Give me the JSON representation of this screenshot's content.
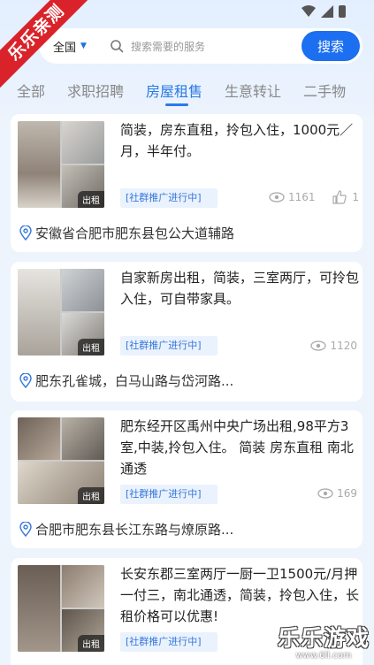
{
  "status": {
    "icons": [
      "wifi-icon",
      "signal-icon",
      "battery-icon"
    ]
  },
  "ribbon": "乐乐亲测",
  "search": {
    "city": "全国",
    "placeholder": "搜索需要的服务",
    "button": "搜索"
  },
  "tabs": [
    {
      "label": "全部"
    },
    {
      "label": "求职招聘"
    },
    {
      "label": "房屋租售",
      "active": true
    },
    {
      "label": "生意转让"
    },
    {
      "label": "二手物"
    }
  ],
  "listings": [
    {
      "title": "简装，房东直租，拎包入住，1000元／月，半年付。",
      "rent_tag": "出租",
      "promo": "[社群推广进行中]",
      "views": "1161",
      "likes": "1",
      "location": "安徽省合肥市肥东县包公大道辅路"
    },
    {
      "title": "自家新房出租，简装，三室两厅，可拎包入住，可自带家具。",
      "rent_tag": "出租",
      "promo": "[社群推广进行中]",
      "views": "1120",
      "location": "肥东孔雀城，白马山路与岱河路..."
    },
    {
      "title": "肥东经开区禹州中央广场出租,98平方3室,中装,拎包入住。 简装 房东直租 南北通透",
      "rent_tag": "出租",
      "promo": "[社群推广进行中]",
      "views": "169",
      "location": "合肥市肥东县长江东路与燎原路..."
    },
    {
      "title": "长安东郡三室两厅一厨一卫1500元/月押一付三，南北通透，简装，拎包入住，长租价格可以优惠!",
      "rent_tag": "出租",
      "promo": "[社群推广进行中]"
    }
  ],
  "watermark": {
    "title": "乐乐游戏",
    "url": "www.6ll.com"
  },
  "colors": {
    "accent": "#1b6ff0",
    "ribbon": "#d9222a",
    "bg": "#eef4fc"
  }
}
